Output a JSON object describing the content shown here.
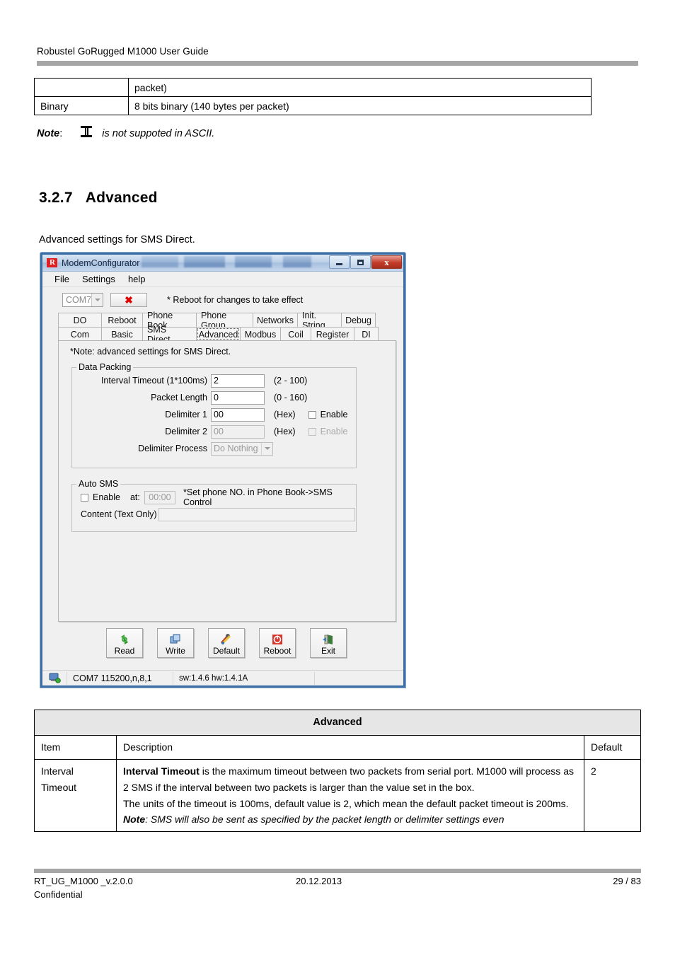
{
  "document": {
    "header_title": "Robustel GoRugged M1000 User Guide",
    "top_table": {
      "rows": [
        {
          "item": "",
          "desc": "packet)"
        },
        {
          "item": "Binary",
          "desc": "8 bits binary (140 bytes per packet)"
        }
      ]
    },
    "note": {
      "label": "Note",
      "colon": ":",
      "glyph_name": "i-beam-glyph",
      "text": "is not suppoted in ASCII."
    },
    "heading": {
      "number": "3.2.7",
      "title": "Advanced"
    },
    "intro": "Advanced settings for SMS Direct.",
    "desc_table": {
      "title": "Advanced",
      "headers": {
        "item": "Item",
        "description": "Description",
        "default": "Default"
      },
      "rows": [
        {
          "item_line1": "Interval",
          "item_line2": "Timeout",
          "desc_bold": "Interval Timeout",
          "desc_part1": " is the maximum timeout between two packets from serial port. M1000 will process as 2 SMS if the interval between two packets is larger than the value set in the box.",
          "desc_part2": "The units of the timeout is 100ms, default value is 2, which mean the default packet timeout is 200ms.",
          "desc_note_label": "Note",
          "desc_note_text": ": SMS will also be sent as specified by the packet length or delimiter settings even",
          "default": "2"
        }
      ]
    },
    "footer": {
      "left": "RT_UG_M1000 _v.2.0.0",
      "middle": "20.12.2013",
      "right": "29 / 83",
      "confidential": "Confidential"
    }
  },
  "app_window": {
    "title": "ModemConfigurator",
    "logo_text": "R",
    "window_controls": {
      "minimize": "minimize-icon",
      "maximize": "maximize-icon",
      "close": "x"
    },
    "menu": [
      "File",
      "Settings",
      "help"
    ],
    "toolbar": {
      "com_port": "COM7",
      "disconnect_button": "✖",
      "reboot_hint": "* Reboot for changes to take effect"
    },
    "tabs_row1": [
      "DO",
      "Reboot",
      "Phone Book",
      "Phone Group",
      "Networks",
      "Init. String",
      "Debug"
    ],
    "tabs_row2": [
      "Com",
      "Basic",
      "SMS Direct",
      "Advanced",
      "Modbus",
      "Coil",
      "Register",
      "DI"
    ],
    "selected_tab": "Advanced",
    "panel": {
      "note": "*Note: advanced settings for SMS Direct.",
      "data_packing": {
        "legend": "Data Packing",
        "interval_timeout_label": "Interval Timeout (1*100ms)",
        "interval_timeout_value": "2",
        "interval_timeout_range": "(2 - 100)",
        "packet_length_label": "Packet Length",
        "packet_length_value": "0",
        "packet_length_range": "(0 - 160)",
        "delimiter1_label": "Delimiter 1",
        "delimiter1_value": "00",
        "delimiter1_hex": "(Hex)",
        "delimiter1_enable": "Enable",
        "delimiter2_label": "Delimiter 2",
        "delimiter2_value": "00",
        "delimiter2_hex": "(Hex)",
        "delimiter2_enable": "Enable",
        "delimiter_process_label": "Delimiter Process",
        "delimiter_process_value": "Do Nothing"
      },
      "auto_sms": {
        "legend": "Auto SMS",
        "enable_label": "Enable",
        "at_label": "at:",
        "time_value": "00:00",
        "hint": "*Set phone NO. in Phone Book->SMS Control",
        "content_label": "Content (Text Only)",
        "content_value": ""
      }
    },
    "buttons": [
      {
        "label": "Read",
        "icon": "recycle-icon"
      },
      {
        "label": "Write",
        "icon": "copy-icon"
      },
      {
        "label": "Default",
        "icon": "tools-icon"
      },
      {
        "label": "Reboot",
        "icon": "power-icon"
      },
      {
        "label": "Exit",
        "icon": "exit-door-icon"
      }
    ],
    "statusbar": {
      "icon": "connection-icon",
      "port": "COM7 115200,n,8,1",
      "versions": "sw:1.4.6 hw:1.4.1A",
      "extra": ""
    }
  },
  "colors": {
    "accent_blue": "#3a6ea5",
    "rule_gray": "#a6a6a6",
    "close_red": "#c33c28",
    "logo_red": "#e02020"
  }
}
